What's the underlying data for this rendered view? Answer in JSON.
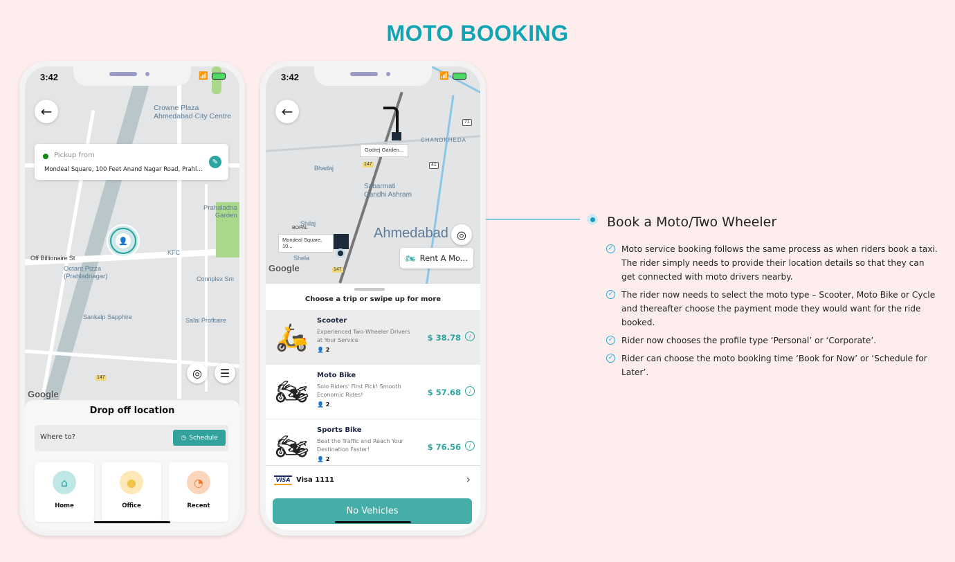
{
  "page_title": "MOTO BOOKING",
  "phone1": {
    "status_time": "3:42",
    "map_labels": {
      "crowne": "Crowne Plaza\nAhmedabad City Centre",
      "prahaladnagar_garden": "Prahaladna\nGarden",
      "off_billionaire": "Off Billionaire St",
      "kfc": "KFC",
      "octant": "Octant Pizza\n(Prahladnagar)",
      "connplex": "Connplex Sm",
      "sankalp": "Sankalp Sapphire",
      "safal": "Safal Profitaire",
      "route_147": "147",
      "google": "Google"
    },
    "pickup": {
      "label": "Pickup from",
      "address": "Mondeal Square, 100 Feet Anand Nagar Road, Prahl..."
    },
    "dropoff": {
      "title": "Drop off location",
      "placeholder": "Where to?",
      "schedule_label": "Schedule"
    },
    "favorites": [
      {
        "label": "Home",
        "icon": "home-icon",
        "color": "#bfe7e6"
      },
      {
        "label": "Office",
        "icon": "office-icon",
        "color": "#fde9b8"
      },
      {
        "label": "Recent",
        "icon": "recent-icon",
        "color": "#fbd6bd"
      }
    ]
  },
  "phone2": {
    "status_time": "3:42",
    "map_labels": {
      "chandkheda": "CHANDKHEDA",
      "godrej": "Godrej Garden...",
      "bhadaj": "Bhadaj",
      "sabarmati": "Sabarmati\nGandhi Ashram",
      "shilaj": "Shilaj",
      "bopal": "BOPAL",
      "ahmedabad": "Ahmedabad",
      "mondeal": "Mondeal Square, 10...",
      "shela": "Shela",
      "route_147": "147",
      "route_71": "71",
      "route_41": "41",
      "google": "Google"
    },
    "rent_label": "Rent A Mo...",
    "choose_text": "Choose a trip or swipe up for more",
    "vehicles": [
      {
        "name": "Scooter",
        "desc": "Experienced Two-Wheeler Drivers at Your Service",
        "capacity": "2",
        "price": "$ 38.78",
        "selected": true
      },
      {
        "name": "Moto Bike",
        "desc": "Solo Riders' First Pick! Smooth Economic Rides!",
        "capacity": "2",
        "price": "$ 57.68",
        "selected": false
      },
      {
        "name": "Sports Bike",
        "desc": "Beat the Traffic and Reach Your Destination Faster!",
        "capacity": "2",
        "price": "$ 76.56",
        "selected": false
      }
    ],
    "payment": {
      "brand": "VISA",
      "label": "Visa 1111"
    },
    "action_label": "No Vehicles"
  },
  "feature": {
    "title": "Book a Moto/Two Wheeler",
    "points": [
      "Moto service booking follows the same process as when riders book a taxi. The rider simply needs to provide their location details so that they can get connected with moto drivers nearby.",
      "The rider now needs to select the moto type – Scooter, Moto Bike or Cycle and thereafter choose the payment mode they would want for the ride booked.",
      "Rider now chooses the profile type ‘Personal’ or ‘Corporate’.",
      "Rider can choose the moto booking time ‘Book for Now’ or ‘Schedule for Later’."
    ]
  },
  "colors": {
    "accent": "#11a4b4",
    "teal_button": "#45aea9",
    "background": "#fdeeed"
  }
}
